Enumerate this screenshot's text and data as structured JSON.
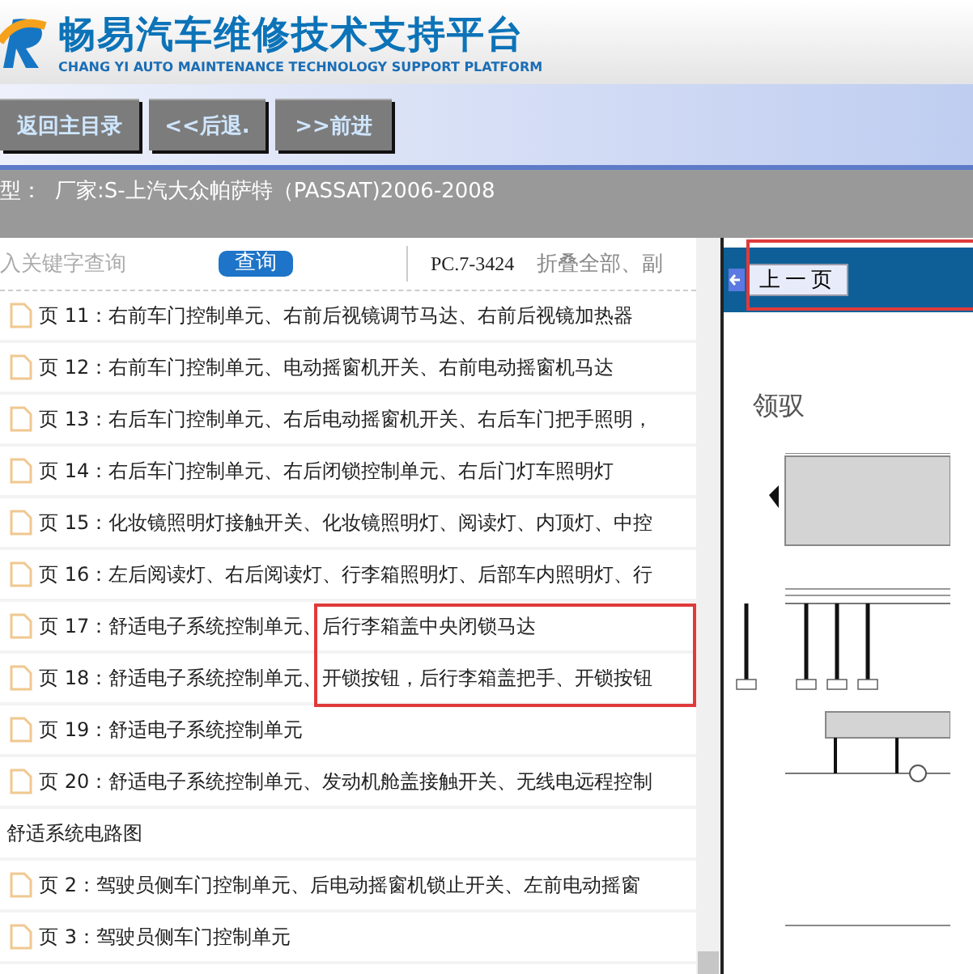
{
  "header": {
    "title": "畅易汽车维修技术支持平台",
    "subtitle": "CHANG YI AUTO MAINTENANCE TECHNOLOGY SUPPORT PLATFORM"
  },
  "nav": {
    "buttons": [
      "返回主目录",
      "<<后退.",
      ">>前进"
    ]
  },
  "model_bar": {
    "label": "型：",
    "value": "厂家:S-上汽大众帕萨特（PASSAT)2006-2008"
  },
  "search": {
    "placeholder": "入关键字查询",
    "button": "查询"
  },
  "toolbar": {
    "code": "PC.7-3424",
    "collapse": "折叠全部、副"
  },
  "list": [
    {
      "kind": "page",
      "text": "页 11：右前车门控制单元、右前后视镜调节马达、右前后视镜加热器"
    },
    {
      "kind": "page",
      "text": "页 12：右前车门控制单元、电动摇窗机开关、右前电动摇窗机马达"
    },
    {
      "kind": "page",
      "text": "页 13：右后车门控制单元、右后电动摇窗机开关、右后车门把手照明，"
    },
    {
      "kind": "page",
      "text": "页 14：右后车门控制单元、右后闭锁控制单元、右后门灯车照明灯"
    },
    {
      "kind": "page",
      "text": "页 15：化妆镜照明灯接触开关、化妆镜照明灯、阅读灯、内顶灯、中控"
    },
    {
      "kind": "page",
      "text": "页 16：左后阅读灯、右后阅读灯、行李箱照明灯、后部车内照明灯、行"
    },
    {
      "kind": "page",
      "text": "页 17：舒适电子系统控制单元、后行李箱盖中央闭锁马达"
    },
    {
      "kind": "page",
      "text": "页 18：舒适电子系统控制单元、开锁按钮，后行李箱盖把手、开锁按钮"
    },
    {
      "kind": "page",
      "text": "页 19：舒适电子系统控制单元"
    },
    {
      "kind": "page",
      "text": "页 20：舒适电子系统控制单元、发动机舱盖接触开关、无线电远程控制"
    },
    {
      "kind": "section",
      "text": "舒适系统电路图"
    },
    {
      "kind": "page",
      "text": "页 2：驾驶员侧车门控制单元、后电动摇窗机锁止开关、左前电动摇窗"
    },
    {
      "kind": "page",
      "text": "页 3：驾驶员侧车门控制单元"
    }
  ],
  "viewer": {
    "prev_button": "上一页",
    "heading": "领驭"
  }
}
